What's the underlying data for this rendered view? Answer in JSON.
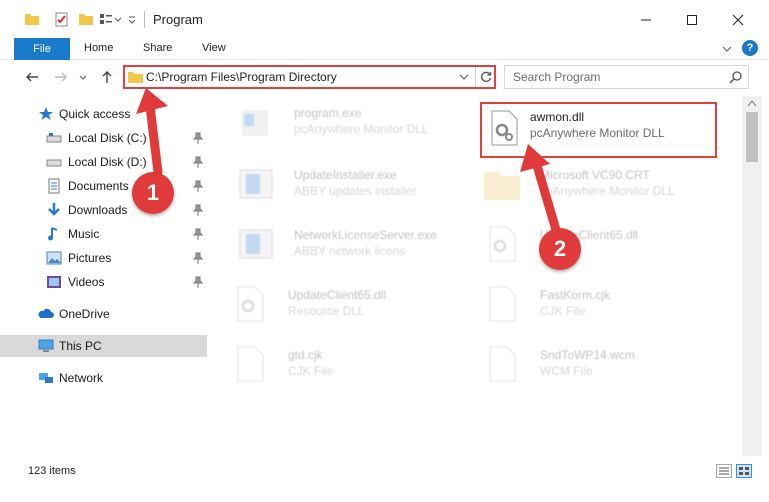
{
  "window": {
    "title": "Program",
    "minimize_label": "Minimize",
    "maximize_label": "Maximize",
    "close_label": "Close"
  },
  "ribbon": {
    "tabs": [
      "File",
      "Home",
      "Share",
      "View"
    ]
  },
  "address": {
    "path": "C:\\Program Files\\Program Directory",
    "search_placeholder": "Search Program"
  },
  "sidebar": {
    "items": [
      {
        "label": "Quick access",
        "icon": "star-icon"
      },
      {
        "label": "Local Disk (C:)",
        "icon": "drive-icon",
        "pinned": true
      },
      {
        "label": "Local Disk (D:)",
        "icon": "drive-icon",
        "pinned": true
      },
      {
        "label": "Documents",
        "icon": "documents-icon",
        "pinned": true
      },
      {
        "label": "Downloads",
        "icon": "download-icon",
        "pinned": true
      },
      {
        "label": "Music",
        "icon": "music-icon",
        "pinned": true
      },
      {
        "label": "Pictures",
        "icon": "pictures-icon",
        "pinned": true
      },
      {
        "label": "Videos",
        "icon": "videos-icon",
        "pinned": true
      },
      {
        "label": "OneDrive",
        "icon": "cloud-icon"
      },
      {
        "label": "This PC",
        "icon": "computer-icon",
        "selected": true
      },
      {
        "label": "Network",
        "icon": "network-icon"
      }
    ]
  },
  "files": [
    {
      "name": "program.exe",
      "desc": "pcAnywhere Monitor DLL",
      "icon": "exe-icon",
      "faded": true
    },
    {
      "name": "awmon.dll",
      "desc": "pcAnywhere Monitor DLL",
      "icon": "dll-icon",
      "highlighted": true
    },
    {
      "name": "UpdateInstaller.exe",
      "desc": "ABBY updates installer",
      "icon": "installer-icon",
      "faded": true
    },
    {
      "name": "Microsoft VC90 CRT",
      "desc": "pcAnywhere Monitor DLL",
      "icon": "folder-icon",
      "faded": true
    },
    {
      "name": "NetworkLicenseServer.exe",
      "desc": "ABBY network licens",
      "icon": "installer-icon",
      "faded": true
    },
    {
      "name": "UpdateClient65.dll",
      "desc": "",
      "icon": "dll-icon",
      "faded": true
    },
    {
      "name": "UpdateClient65.dll",
      "desc": "Resource DLL",
      "icon": "dll-icon",
      "faded": true
    },
    {
      "name": "FastKorm.cjk",
      "desc": "CJK File",
      "icon": "file-icon",
      "faded": true
    },
    {
      "name": "gtd.cjk",
      "desc": "CJK File",
      "icon": "file-icon",
      "faded": true
    },
    {
      "name": "SndToWP14.wcm",
      "desc": "WCM File",
      "icon": "file-icon",
      "faded": true
    }
  ],
  "status": {
    "item_count": "123 items"
  },
  "annotations": {
    "step1": "1",
    "step2": "2",
    "accent_color": "#e03a3a"
  }
}
